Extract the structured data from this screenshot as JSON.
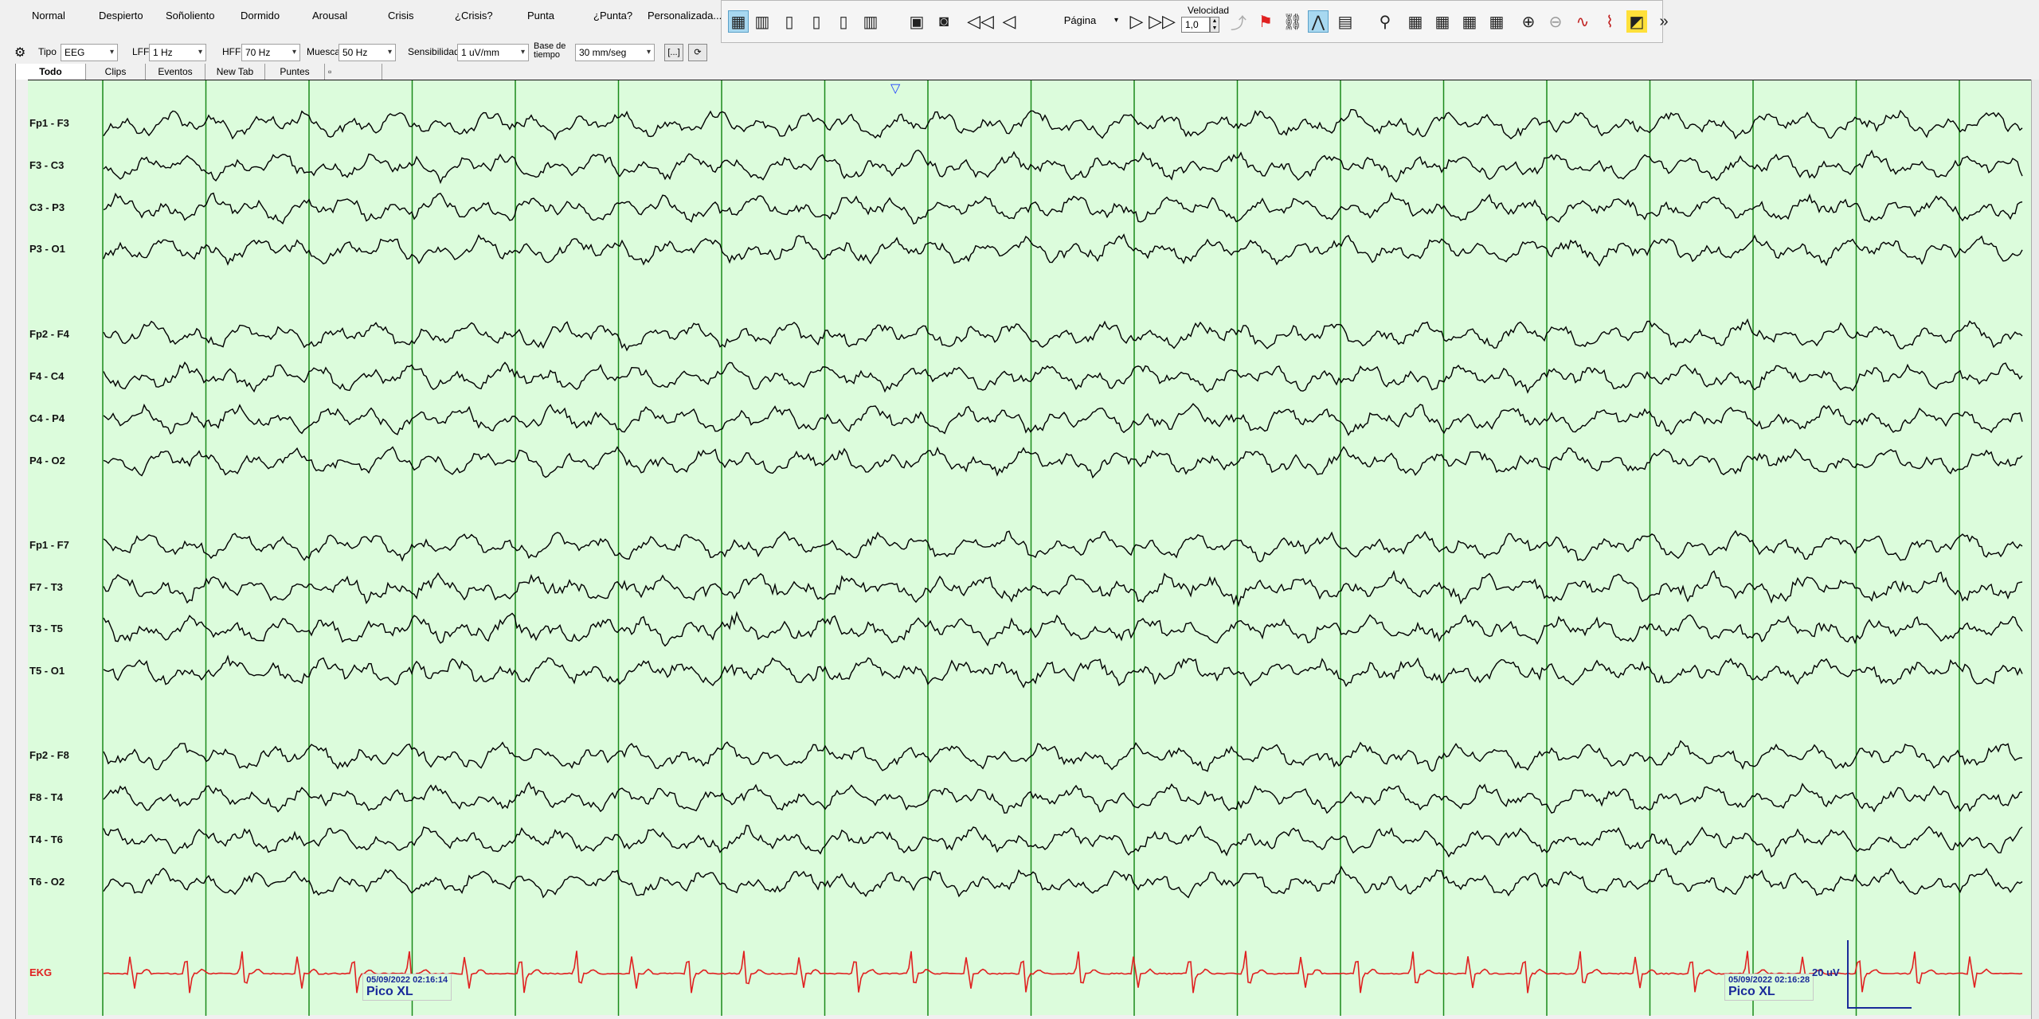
{
  "event_buttons": [
    "Normal",
    "Despierto",
    "Soñoliento",
    "Dormido",
    "Arousal",
    "Crisis",
    "¿Crisis?",
    "Punta",
    "¿Punta?",
    "Personalizada..."
  ],
  "toolbar": {
    "page_label": "Página",
    "speed_label": "Velocidad",
    "speed_value": "1,0",
    "icons": [
      "montage-icon",
      "montage-book-icon",
      "layout-1-icon",
      "layout-2-icon",
      "layout-3-icon",
      "layout-4-icon",
      "video-archive-icon",
      "video-camera-icon",
      "rewind-icon",
      "prev-icon",
      "next-icon",
      "fast-forward-icon",
      "cursor-off-icon",
      "event-marker-icon",
      "link-icon",
      "wave-mode-icon",
      "table-icon",
      "search-person-icon",
      "db-1-icon",
      "db-2-icon",
      "db-3-icon",
      "db-4-icon",
      "zoom-in-icon",
      "zoom-out-icon",
      "spike-icon",
      "wave-detect-icon",
      "photo-icon",
      "more-icon"
    ]
  },
  "settings": {
    "tipo_label": "Tipo",
    "tipo_value": "EEG",
    "lff_label": "LFF",
    "lff_value": "1 Hz",
    "hff_label": "HFF",
    "hff_value": "70 Hz",
    "muesca_label": "Muesca",
    "muesca_value": "50 Hz",
    "sensibilidad_label": "Sensibilidad",
    "sensibilidad_value": "1 uV/mm",
    "base_label_1": "Base de",
    "base_label_2": "tiempo",
    "base_value": "30 mm/seg",
    "bracket_btn": "[...]"
  },
  "tabs": [
    "Todo",
    "Clips",
    "Eventos",
    "New Tab",
    "Puntes"
  ],
  "channels": [
    {
      "label": "Fp1 - F3"
    },
    {
      "label": "F3 - C3"
    },
    {
      "label": "C3 - P3"
    },
    {
      "label": "P3 - O1"
    },
    {
      "label": "Fp2 - F4"
    },
    {
      "label": "F4 - C4"
    },
    {
      "label": "C4 - P4"
    },
    {
      "label": "P4 - O2"
    },
    {
      "label": "Fp1 - F7"
    },
    {
      "label": "F7 - T3"
    },
    {
      "label": "T3 - T5"
    },
    {
      "label": "T5 - O1"
    },
    {
      "label": "Fp2 - F8"
    },
    {
      "label": "F8 - T4"
    },
    {
      "label": "T4 - T6"
    },
    {
      "label": "T6 - O2"
    },
    {
      "label": "EKG"
    }
  ],
  "markers": [
    {
      "time": "05/09/2022 02:16:14",
      "label": "Pico XL"
    },
    {
      "time": "05/09/2022 02:16:28",
      "label": "Pico XL"
    }
  ],
  "scale_text": "20 uV",
  "colors": {
    "eeg_bg": "#dcfcdc",
    "trace": "#000000",
    "ekg": "#e02020",
    "gridline": "#1a8a1a",
    "marker_text": "#1a2a9a"
  }
}
